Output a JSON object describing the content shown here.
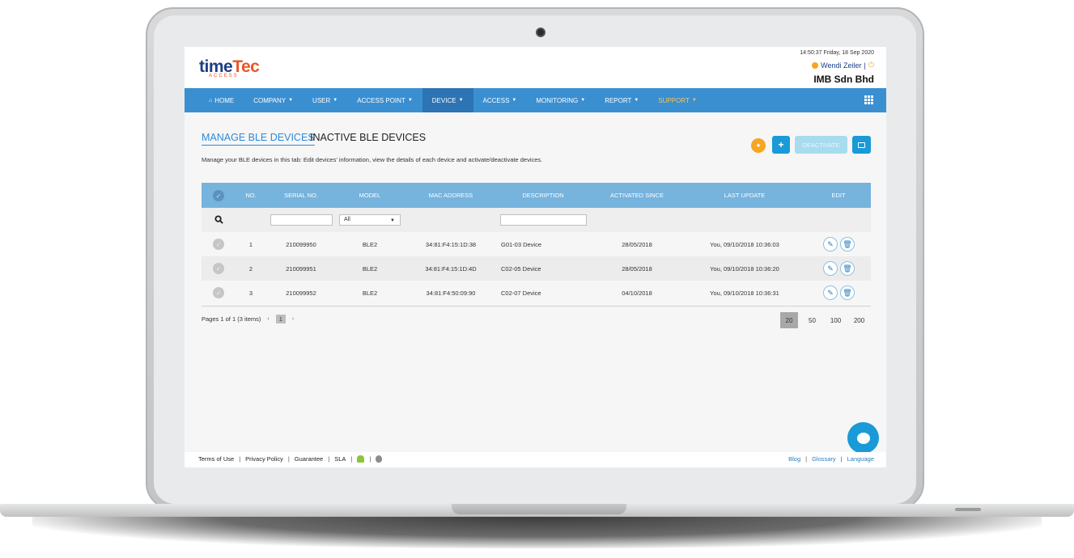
{
  "header": {
    "logo_main_a": "time",
    "logo_main_b": "Tec",
    "logo_sub": "ACCESS",
    "datetime": "14:50:37 Friday, 18 Sep 2020",
    "user_name": "Wendi Zeiler",
    "user_sep": "|",
    "company": "IMB Sdn Bhd"
  },
  "nav": {
    "items": [
      {
        "label": "HOME",
        "icon": "home-icon"
      },
      {
        "label": "COMPANY"
      },
      {
        "label": "USER"
      },
      {
        "label": "ACCESS POINT"
      },
      {
        "label": "DEVICE",
        "active": true
      },
      {
        "label": "ACCESS"
      },
      {
        "label": "MONITORING"
      },
      {
        "label": "REPORT"
      },
      {
        "label": "SUPPORT",
        "color": "#f7c55c"
      }
    ],
    "bar_color": "#3a8fd1"
  },
  "tabs": {
    "active": "MANAGE BLE DEVICES",
    "inactive": "INACTIVE BLE DEVICES"
  },
  "description": "Manage your BLE devices in this tab: Edit devices' information, view the details of each device and activate/deactivate devices.",
  "toolbar": {
    "add_label": "+",
    "deactivate_label": "DEACTIVATE"
  },
  "table": {
    "columns": [
      "NO.",
      "SERIAL NO.",
      "MODEL",
      "MAC ADDRESS",
      "DESCRIPTION",
      "ACTIVATED SINCE",
      "LAST UPDATE",
      "EDIT"
    ],
    "filter_model_value": "All",
    "rows": [
      {
        "no": "1",
        "serial": "210099950",
        "model": "BLE2",
        "mac": "34:81:F4:15:1D:38",
        "description": "G01-03 Device",
        "activated": "28/05/2018",
        "last_update": "You, 09/10/2018 10:36:03"
      },
      {
        "no": "2",
        "serial": "210099951",
        "model": "BLE2",
        "mac": "34:81:F4:15:1D:4D",
        "description": "C02-05 Device",
        "activated": "28/05/2018",
        "last_update": "You, 09/10/2018 10:36:20"
      },
      {
        "no": "3",
        "serial": "210099952",
        "model": "BLE2",
        "mac": "34:81:F4:50:09:90",
        "description": "C02-07 Device",
        "activated": "04/10/2018",
        "last_update": "You, 09/10/2018 10:36:31"
      }
    ]
  },
  "pagination": {
    "summary": "Pages 1 of 1 (3 items)",
    "prev": "‹",
    "current": "1",
    "next": "›",
    "page_sizes": [
      "20",
      "50",
      "100",
      "200"
    ],
    "selected_size": "20"
  },
  "footer": {
    "left_links": [
      "Terms of Use",
      "Privacy Policy",
      "Guarantee",
      "SLA"
    ],
    "right_links": [
      "Blog",
      "Glossary",
      "Language"
    ],
    "separator": "|"
  },
  "colors": {
    "accent": "#1a9ad6",
    "table_header": "#76b3dd",
    "brand_orange": "#e8562a",
    "brand_navy": "#1b3e86"
  }
}
